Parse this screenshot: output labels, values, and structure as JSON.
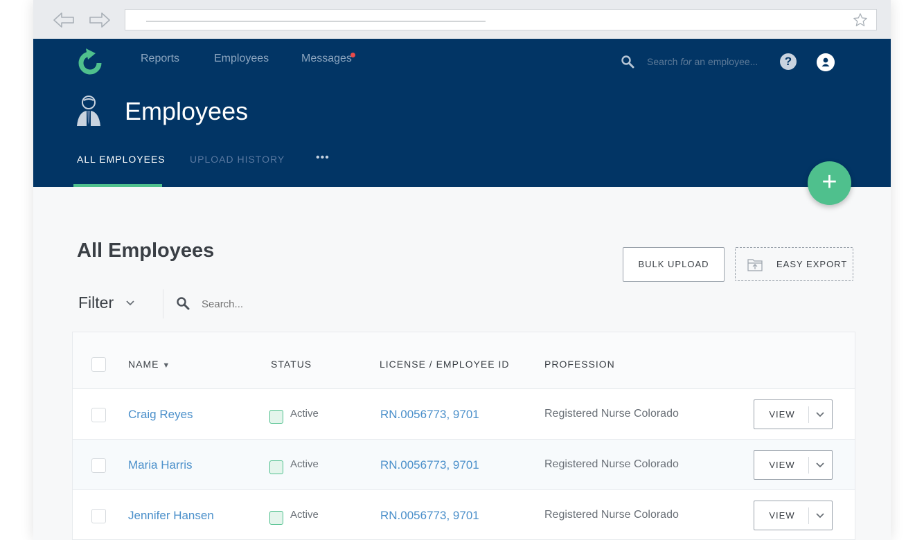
{
  "browser": {
    "back_icon": "back-arrow-icon",
    "forward_icon": "forward-arrow-icon",
    "bookmark_icon": "star-icon"
  },
  "nav": {
    "items": [
      "Reports",
      "Employees",
      "Messages"
    ],
    "search_prefix": "Search ",
    "search_italic": "for",
    "search_suffix": " an employee...",
    "help_label": "?",
    "notification_color": "#e84a4a"
  },
  "header": {
    "title": "Employees",
    "tabs": [
      {
        "label": "ALL EMPLOYEES",
        "active": true
      },
      {
        "label": "UPLOAD HISTORY",
        "active": false
      }
    ],
    "more_label": "•••",
    "add_label": "+",
    "background": "#023565",
    "accent": "#4fc08d"
  },
  "content": {
    "section_title": "All Employees",
    "bulk_upload_label": "BULK UPLOAD",
    "easy_export_label": "EASY EXPORT",
    "filter_label": "Filter",
    "search_placeholder": "Search..."
  },
  "table": {
    "columns": [
      "NAME",
      "STATUS",
      "LICENSE / EMPLOYEE ID",
      "PROFESSION"
    ],
    "sort_indicator": "▼",
    "view_label": "VIEW",
    "rows": [
      {
        "name": "Craig Reyes",
        "status": "Active",
        "license": "RN.0056773, 9701",
        "profession": "Registered Nurse Colorado"
      },
      {
        "name": "Maria Harris",
        "status": "Active",
        "license": "RN.0056773, 9701",
        "profession": "Registered Nurse Colorado"
      },
      {
        "name": "Jennifer Hansen",
        "status": "Active",
        "license": "RN.0056773, 9701",
        "profession": "Registered Nurse Colorado"
      }
    ]
  }
}
